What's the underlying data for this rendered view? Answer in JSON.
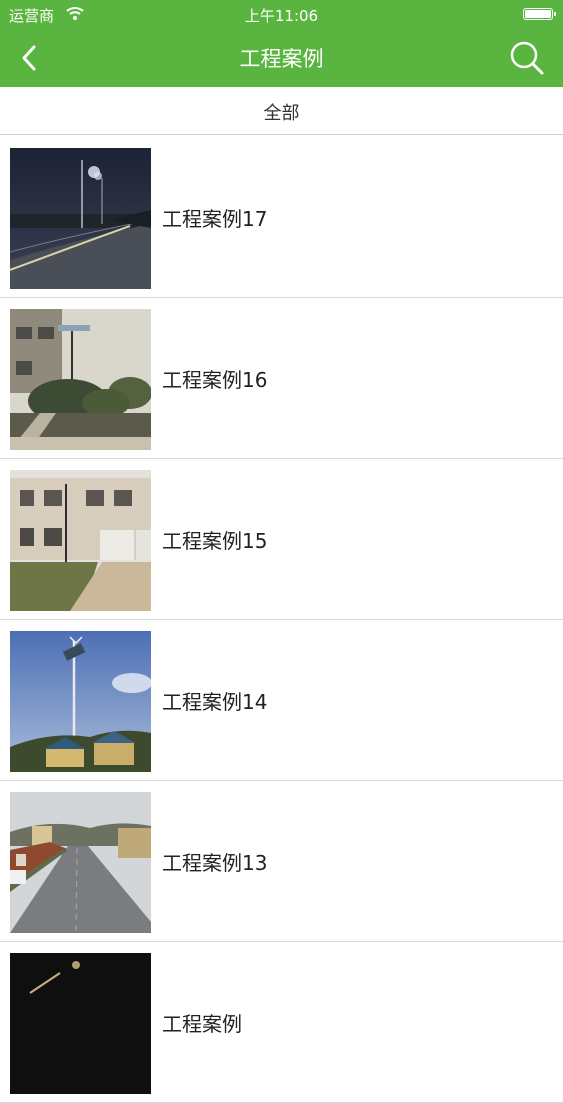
{
  "status_bar": {
    "carrier": "运营商",
    "time": "上午11:06"
  },
  "nav": {
    "title": "工程案例",
    "back_icon": "chevron-left-icon",
    "search_icon": "search-icon"
  },
  "filter": {
    "label": "全部"
  },
  "cases": [
    {
      "title": "工程案例17"
    },
    {
      "title": "工程案例16"
    },
    {
      "title": "工程案例15"
    },
    {
      "title": "工程案例14"
    },
    {
      "title": "工程案例13"
    },
    {
      "title": "工程案例"
    }
  ],
  "colors": {
    "header": "#5ab540",
    "divider": "#d9d9d9"
  }
}
